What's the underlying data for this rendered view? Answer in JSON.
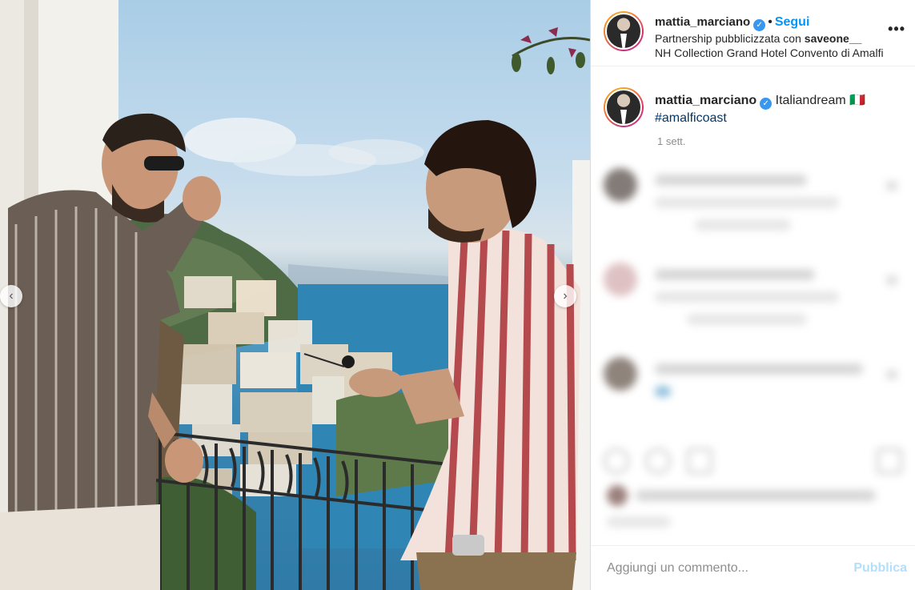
{
  "header": {
    "username": "mattia_marciano",
    "follow_label": "Segui",
    "partnership_prefix": "Partnership pubblicizzata con",
    "partner": "saveone__",
    "location": "NH Collection Grand Hotel Convento di Amalfi",
    "more_icon": "more-options-icon"
  },
  "caption": {
    "username": "mattia_marciano",
    "text": "Italiandream 🇮🇹",
    "hashtag": "#amalficoast",
    "time": "1 sett."
  },
  "composer": {
    "placeholder": "Aggiungi un commento...",
    "publish_label": "Pubblica"
  },
  "photo": {
    "prev_icon": "chevron-left-icon",
    "next_icon": "chevron-right-icon"
  },
  "colors": {
    "accent": "#0095f6",
    "verified": "#3897f0",
    "publish_disabled": "#b2dffc"
  }
}
